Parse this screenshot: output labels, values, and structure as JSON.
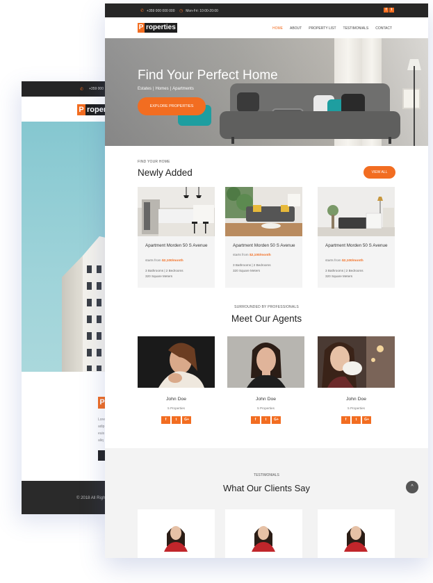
{
  "back_page": {
    "phone": "+359 000",
    "logo_letter": "P",
    "logo_rest": "roper",
    "logo2_letter": "P",
    "body_lines": [
      "Lore",
      "adip",
      "euis",
      "aliq"
    ],
    "footer": "© 2018 All Righ"
  },
  "topbar": {
    "phone": "+359 000 000 000",
    "hours": "Mon-Fri: 10:00-20:00",
    "social": [
      "f",
      "t"
    ]
  },
  "logo": {
    "letter": "P",
    "rest": "roperties"
  },
  "nav": {
    "items": [
      "HOME",
      "ABOUT",
      "PROPERTY LIST",
      "TESTIMONIALS",
      "CONTACT"
    ],
    "active": "HOME"
  },
  "hero": {
    "title": "Find Your Perfect Home",
    "sub": [
      "Estates",
      "|",
      "Homes",
      "|",
      "Apartments"
    ],
    "button": "EXPLORE PROPERTIES"
  },
  "newly_added": {
    "kicker": "FIND YOUR HOME",
    "title": "Newly Added",
    "button": "VIEW ALL",
    "cards": [
      {
        "title": "Apartment Morden 50 S Avenue",
        "price_prefix": "starts from",
        "price": "$2,100/month",
        "beds_baths": "3 Bathrooms   |   2 Bedrooms",
        "area": "320 Square Meters"
      },
      {
        "title": "Apartment Morden 50 S Avenue",
        "price_prefix": "starts from",
        "price": "$2,100/month",
        "beds_baths": "3 Bathrooms   |   2 Bedrooms",
        "area": "320 Square Meters"
      },
      {
        "title": "Apartment Morden 50 S Avenue",
        "price_prefix": "starts from",
        "price": "$2,100/month",
        "beds_baths": "3 Bathrooms   |   2 Bedrooms",
        "area": "320 Square Meters"
      }
    ]
  },
  "agents": {
    "kicker": "SURROUNDED BY PROFESSIONALS",
    "title": "Meet Our Agents",
    "list": [
      {
        "name": "John Doe",
        "props": "5 Properties",
        "social": [
          "f",
          "t",
          "G+"
        ]
      },
      {
        "name": "John Doe",
        "props": "5 Properties",
        "social": [
          "f",
          "t",
          "G+"
        ]
      },
      {
        "name": "John Doe",
        "props": "5 Properties",
        "social": [
          "f",
          "t",
          "G+"
        ]
      }
    ]
  },
  "testimonials": {
    "kicker": "TESTIMONIALS",
    "title": "What Our Clients Say"
  },
  "scroll_top": "^",
  "colors": {
    "accent": "#f26d21",
    "dark": "#262626"
  }
}
